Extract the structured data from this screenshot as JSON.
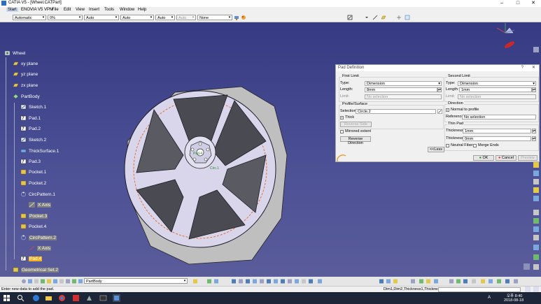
{
  "window": {
    "title": "CATIA V5 - [Wheel.CATPart]",
    "min": "–",
    "max": "□",
    "close": "✕"
  },
  "menu": {
    "items": [
      "Start",
      "ENOVIA V5 VPM",
      "File",
      "Edit",
      "View",
      "Insert",
      "Tools",
      "Window",
      "Help"
    ]
  },
  "toolbar": {
    "combos": [
      {
        "value": "Automatic",
        "enabled": true
      },
      {
        "value": "0%",
        "enabled": true
      },
      {
        "value": "Auto",
        "enabled": true
      },
      {
        "value": "Auto",
        "enabled": true
      },
      {
        "value": "Auto",
        "enabled": true
      },
      {
        "value": "Auto",
        "enabled": false
      },
      {
        "value": "None",
        "enabled": true
      }
    ]
  },
  "tree": {
    "nodes": [
      {
        "label": "Wheel",
        "icon": "part-icon"
      },
      {
        "label": "xy plane",
        "icon": "plane-icon"
      },
      {
        "label": "yz plane",
        "icon": "plane-icon"
      },
      {
        "label": "zx plane",
        "icon": "plane-icon"
      },
      {
        "label": "PartBody",
        "icon": "body-icon"
      },
      {
        "label": "Sketch.1",
        "icon": "sketch-icon"
      },
      {
        "label": "Pad.1",
        "icon": "pad-icon"
      },
      {
        "label": "Pad.2",
        "icon": "pad-icon"
      },
      {
        "label": "Sketch.2",
        "icon": "sketch-icon"
      },
      {
        "label": "ThickSurface.1",
        "icon": "thick-surface-icon"
      },
      {
        "label": "Pad.3",
        "icon": "pad-icon"
      },
      {
        "label": "Pocket.1",
        "icon": "pocket-icon"
      },
      {
        "label": "Pocket.2",
        "icon": "pocket-icon"
      },
      {
        "label": "CircPattern.1",
        "icon": "pattern-icon"
      },
      {
        "label": "X Axis",
        "icon": "axis-icon"
      },
      {
        "label": "Pocket.3",
        "icon": "pocket-icon"
      },
      {
        "label": "Pocket.4",
        "icon": "pocket-icon"
      },
      {
        "label": "CircPattern.2",
        "icon": "pattern-icon"
      },
      {
        "label": "X Axis",
        "icon": "axis-icon"
      },
      {
        "label": "Pad.4",
        "icon": "pad-icon"
      },
      {
        "label": "Geometrical Set.2",
        "icon": "geometrical-set-icon"
      }
    ]
  },
  "dialog": {
    "title": "Pad Definition",
    "help": "?",
    "close": "✕",
    "first_limit": {
      "group": "First Limit",
      "type_label": "Type:",
      "type_value": "Dimension",
      "length_label": "Length:",
      "length_value": "8mm",
      "limit_label": "Limit:",
      "limit_value": "No selection"
    },
    "profile": {
      "group": "Profile/Surface",
      "selection_label": "Selection:",
      "selection_value": "Circle.2",
      "thick_label": "Thick",
      "reverse_side": "Reverse Side"
    },
    "mirrored_label": "Mirrored extent",
    "reverse_direction": "Reverse Direction",
    "second_limit": {
      "group": "Second Limit",
      "type_label": "Type:",
      "type_value": "Dimension",
      "length_label": "Length:",
      "length_value": "1mm",
      "limit_label": "Limit:",
      "limit_value": "No selection"
    },
    "direction": {
      "group": "Direction",
      "normal_label": "Normal to profile",
      "reference_label": "Reference:",
      "reference_value": "No selection"
    },
    "thin_pad": {
      "group": "Thin Pad",
      "thickness1_label": "Thickness1:",
      "thickness1_value": "1mm",
      "thickness2_label": "Thickness2:",
      "thickness2_value": "0mm",
      "neutral_label": "Neutral Fiber",
      "merge_label": "Merge Ends"
    },
    "less_button": "<<Less",
    "ok": "OK",
    "cancel": "Cancel",
    "preview": "Preview"
  },
  "model_labels": {
    "hub": "Pad.4",
    "rim": "Circ.1"
  },
  "bottom": {
    "body_combo": "PartBody"
  },
  "status": {
    "message": "Enter new data to add the pad.",
    "command_value": "Dim1,Dim2,Thickness1,Thickness2 Dimm,1mm,1mm,0mm"
  },
  "taskbar": {
    "time": "오후 8:40",
    "date": "2018-08-18",
    "lang": "A"
  },
  "colors": {
    "viewport_top": "#363a82",
    "viewport_bottom": "#5a5c9a",
    "highlight": "#f2b21d",
    "wheel": "#d9d6ec",
    "sketch": "#e3733d"
  }
}
